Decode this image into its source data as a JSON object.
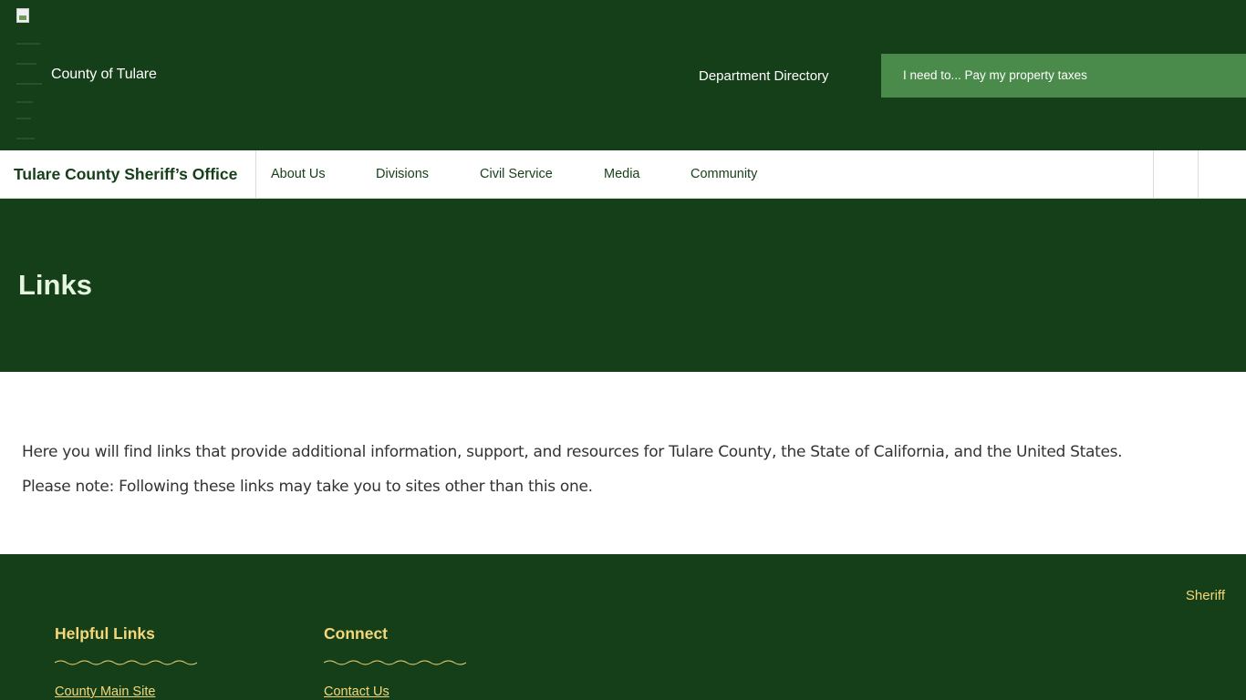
{
  "header": {
    "county_name": "County of Tulare",
    "department_directory": "Department Directory",
    "ineed_text": "I need to... Pay my property taxes"
  },
  "nav": {
    "site_title": "Tulare County Sheriff’s Office",
    "items": [
      {
        "label": "About Us"
      },
      {
        "label": "Divisions"
      },
      {
        "label": "Civil Service"
      },
      {
        "label": "Media"
      },
      {
        "label": "Community"
      }
    ]
  },
  "hero": {
    "title": "Links"
  },
  "main": {
    "intro": "Here you will find links that provide additional information, support, and resources for Tulare County, the State of California, and the United States.",
    "note": "Please note: Following these links may take you to sites other than this one."
  },
  "footer": {
    "sheriff_link": "Sheriff",
    "columns": [
      {
        "heading": "Helpful Links",
        "first_link": "County Main Site"
      },
      {
        "heading": "Connect",
        "first_link": "Contact Us"
      }
    ]
  },
  "colors": {
    "primary_green": "#153f18",
    "accent_green": "#4a8a4a",
    "footer_gold": "#f5d77a",
    "hero_title": "#e6f5e0"
  }
}
